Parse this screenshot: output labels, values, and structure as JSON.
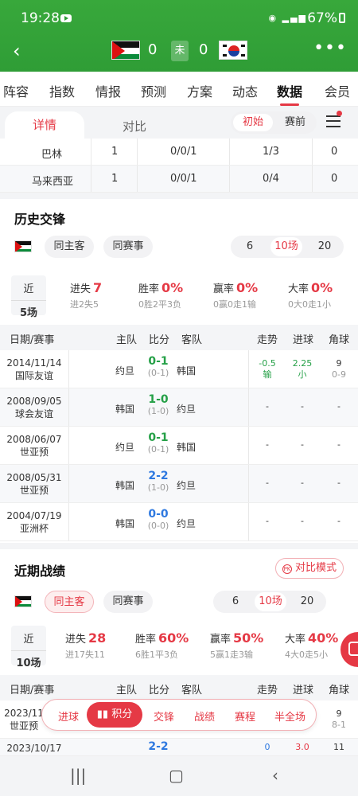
{
  "status": {
    "time": "19:28",
    "battery": "67%"
  },
  "match": {
    "home_score": "0",
    "away_score": "0",
    "state": "未"
  },
  "tabs": [
    "阵容",
    "指数",
    "情报",
    "预测",
    "方案",
    "动态",
    "数据",
    "会员"
  ],
  "subtabs": {
    "detail": "详情",
    "compare": "对比"
  },
  "odds_toggle": {
    "initial": "初始",
    "pre": "赛前"
  },
  "odds_rows": [
    {
      "company": "巴林",
      "a": "1",
      "b": "0/0/1",
      "c": "1/3",
      "d": "0"
    },
    {
      "company": "马来西亚",
      "a": "1",
      "b": "0/0/1",
      "c": "0/4",
      "d": "0"
    }
  ],
  "h2h": {
    "title": "历史交锋",
    "chips": [
      "同主客",
      "同赛事"
    ],
    "counts": [
      "6",
      "10场",
      "20"
    ],
    "summary": {
      "recent": "近",
      "games": "5场"
    },
    "stats": [
      {
        "label": "进失",
        "value": "7",
        "sub": "进2失5"
      },
      {
        "label": "胜率",
        "value": "0%",
        "sub": "0胜2平3负"
      },
      {
        "label": "赢率",
        "value": "0%",
        "sub": "0赢0走1输"
      },
      {
        "label": "大率",
        "value": "0%",
        "sub": "0大0走1小"
      }
    ],
    "headers": [
      "日期/赛事",
      "主队",
      "比分",
      "客队",
      "走势",
      "进球",
      "角球"
    ],
    "rows": [
      {
        "date": "2014/11/14",
        "comp": "国际友谊",
        "home": "约旦",
        "score": "0-1",
        "half": "(0-1)",
        "away": "韩国",
        "trend": "-0.5",
        "trend2": "输",
        "goals": "2.25",
        "goals2": "小",
        "corner": "9",
        "corner2": "0-9"
      },
      {
        "date": "2008/09/05",
        "comp": "球会友谊",
        "home": "韩国",
        "score": "1-0",
        "half": "(1-0)",
        "away": "约旦",
        "trend": "-",
        "trend2": "",
        "goals": "-",
        "goals2": "",
        "corner": "-",
        "corner2": ""
      },
      {
        "date": "2008/06/07",
        "comp": "世亚预",
        "home": "约旦",
        "score": "0-1",
        "half": "(0-1)",
        "away": "韩国",
        "trend": "-",
        "trend2": "",
        "goals": "-",
        "goals2": "",
        "corner": "-",
        "corner2": ""
      },
      {
        "date": "2008/05/31",
        "comp": "世亚预",
        "home": "韩国",
        "score": "2-2",
        "half": "(1-0)",
        "away": "约旦",
        "trend": "-",
        "trend2": "",
        "goals": "-",
        "goals2": "",
        "corner": "-",
        "corner2": ""
      },
      {
        "date": "2004/07/19",
        "comp": "亚洲杯",
        "home": "韩国",
        "score": "0-0",
        "half": "(0-0)",
        "away": "约旦",
        "trend": "-",
        "trend2": "",
        "goals": "-",
        "goals2": "",
        "corner": "-",
        "corner2": ""
      }
    ]
  },
  "recent": {
    "title": "近期战绩",
    "mode_btn": "对比模式",
    "mode_icon": "PK",
    "chips": [
      "同主客",
      "同赛事"
    ],
    "counts": [
      "6",
      "10场",
      "20"
    ],
    "summary": {
      "recent": "近",
      "games": "10场"
    },
    "stats": [
      {
        "label": "进失",
        "value": "28",
        "sub": "进17失11"
      },
      {
        "label": "胜率",
        "value": "60%",
        "sub": "6胜1平3负"
      },
      {
        "label": "赢率",
        "value": "50%",
        "sub": "5赢1走3输"
      },
      {
        "label": "大率",
        "value": "40%",
        "sub": "4大0走5小"
      }
    ],
    "headers": [
      "日期/赛事",
      "主队",
      "比分",
      "客队",
      "走势",
      "进球",
      "角球"
    ],
    "partial_rows": [
      {
        "date": "2023/11",
        "comp": "世亚预",
        "corner": "9",
        "corner2": "8-1"
      },
      {
        "date": "2023/10/17",
        "score": "2-2",
        "trend": "0",
        "goals": "3.0",
        "corner": "11"
      }
    ]
  },
  "bottom_bar": [
    "进球",
    "积分",
    "交锋",
    "战绩",
    "赛程",
    "半全场"
  ],
  "colors": {
    "brand": "#e53945",
    "header": "#2f9d36",
    "win": "#25a047",
    "draw": "#2f79e0"
  }
}
